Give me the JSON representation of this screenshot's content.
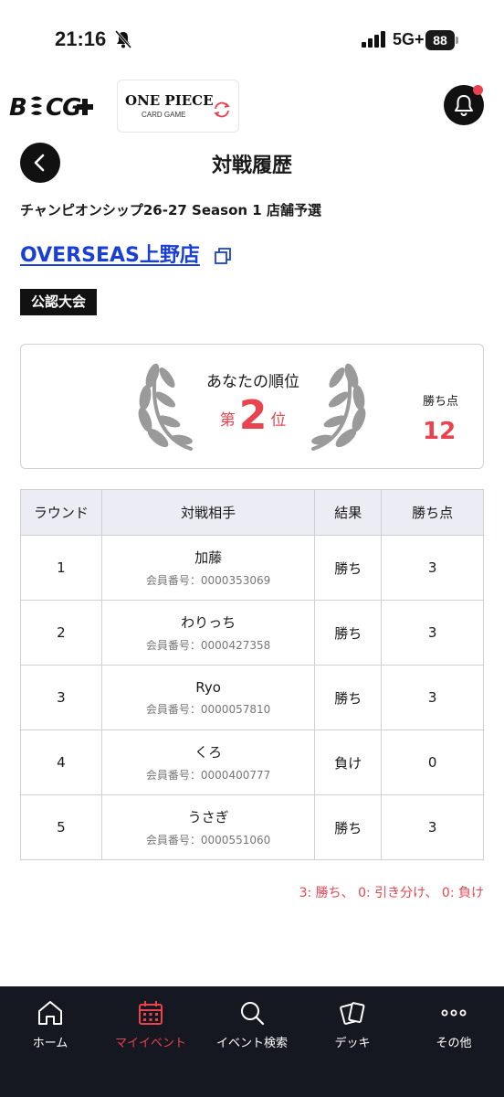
{
  "status_bar": {
    "time": "21:16",
    "network": "5G+",
    "battery": "88"
  },
  "header": {
    "brand_logo": "B",
    "game_logo_title": "ONE PIECE",
    "game_logo_subtitle": "CARD GAME"
  },
  "page": {
    "title": "対戦履歴"
  },
  "event": {
    "name": "チャンピオンシップ26-27 Season 1 店舗予選",
    "store": "OVERSEAS上野店",
    "badge": "公認大会"
  },
  "rank": {
    "label": "あなたの順位",
    "prefix": "第",
    "position": "2",
    "suffix": "位",
    "points_label": "勝ち点",
    "points": "12"
  },
  "table": {
    "headers": [
      "ラウンド",
      "対戦相手",
      "結果",
      "勝ち点"
    ],
    "rows": [
      {
        "round": "1",
        "name": "加藤",
        "member_id": "会員番号：0000353069",
        "result": "勝ち",
        "points": "3"
      },
      {
        "round": "2",
        "name": "わりっち",
        "member_id": "会員番号：0000427358",
        "result": "勝ち",
        "points": "3"
      },
      {
        "round": "3",
        "name": "Ryo",
        "member_id": "会員番号：0000057810",
        "result": "勝ち",
        "points": "3"
      },
      {
        "round": "4",
        "name": "くろ",
        "member_id": "会員番号：0000400777",
        "result": "負け",
        "points": "0"
      },
      {
        "round": "5",
        "name": "うさぎ",
        "member_id": "会員番号：0000551060",
        "result": "勝ち",
        "points": "3"
      }
    ]
  },
  "legend": "3: 勝ち、 0: 引き分け、 0: 負け",
  "nav": [
    {
      "label": "ホーム",
      "icon": "home-icon"
    },
    {
      "label": "マイイベント",
      "icon": "calendar-icon",
      "active": true
    },
    {
      "label": "イベント検索",
      "icon": "search-icon"
    },
    {
      "label": "デッキ",
      "icon": "cards-icon"
    },
    {
      "label": "その他",
      "icon": "more-icon"
    }
  ],
  "colors": {
    "accent": "#e8434f",
    "link": "#1a3fd6",
    "nav_bg": "#161821",
    "header_bg": "#ececf4"
  }
}
